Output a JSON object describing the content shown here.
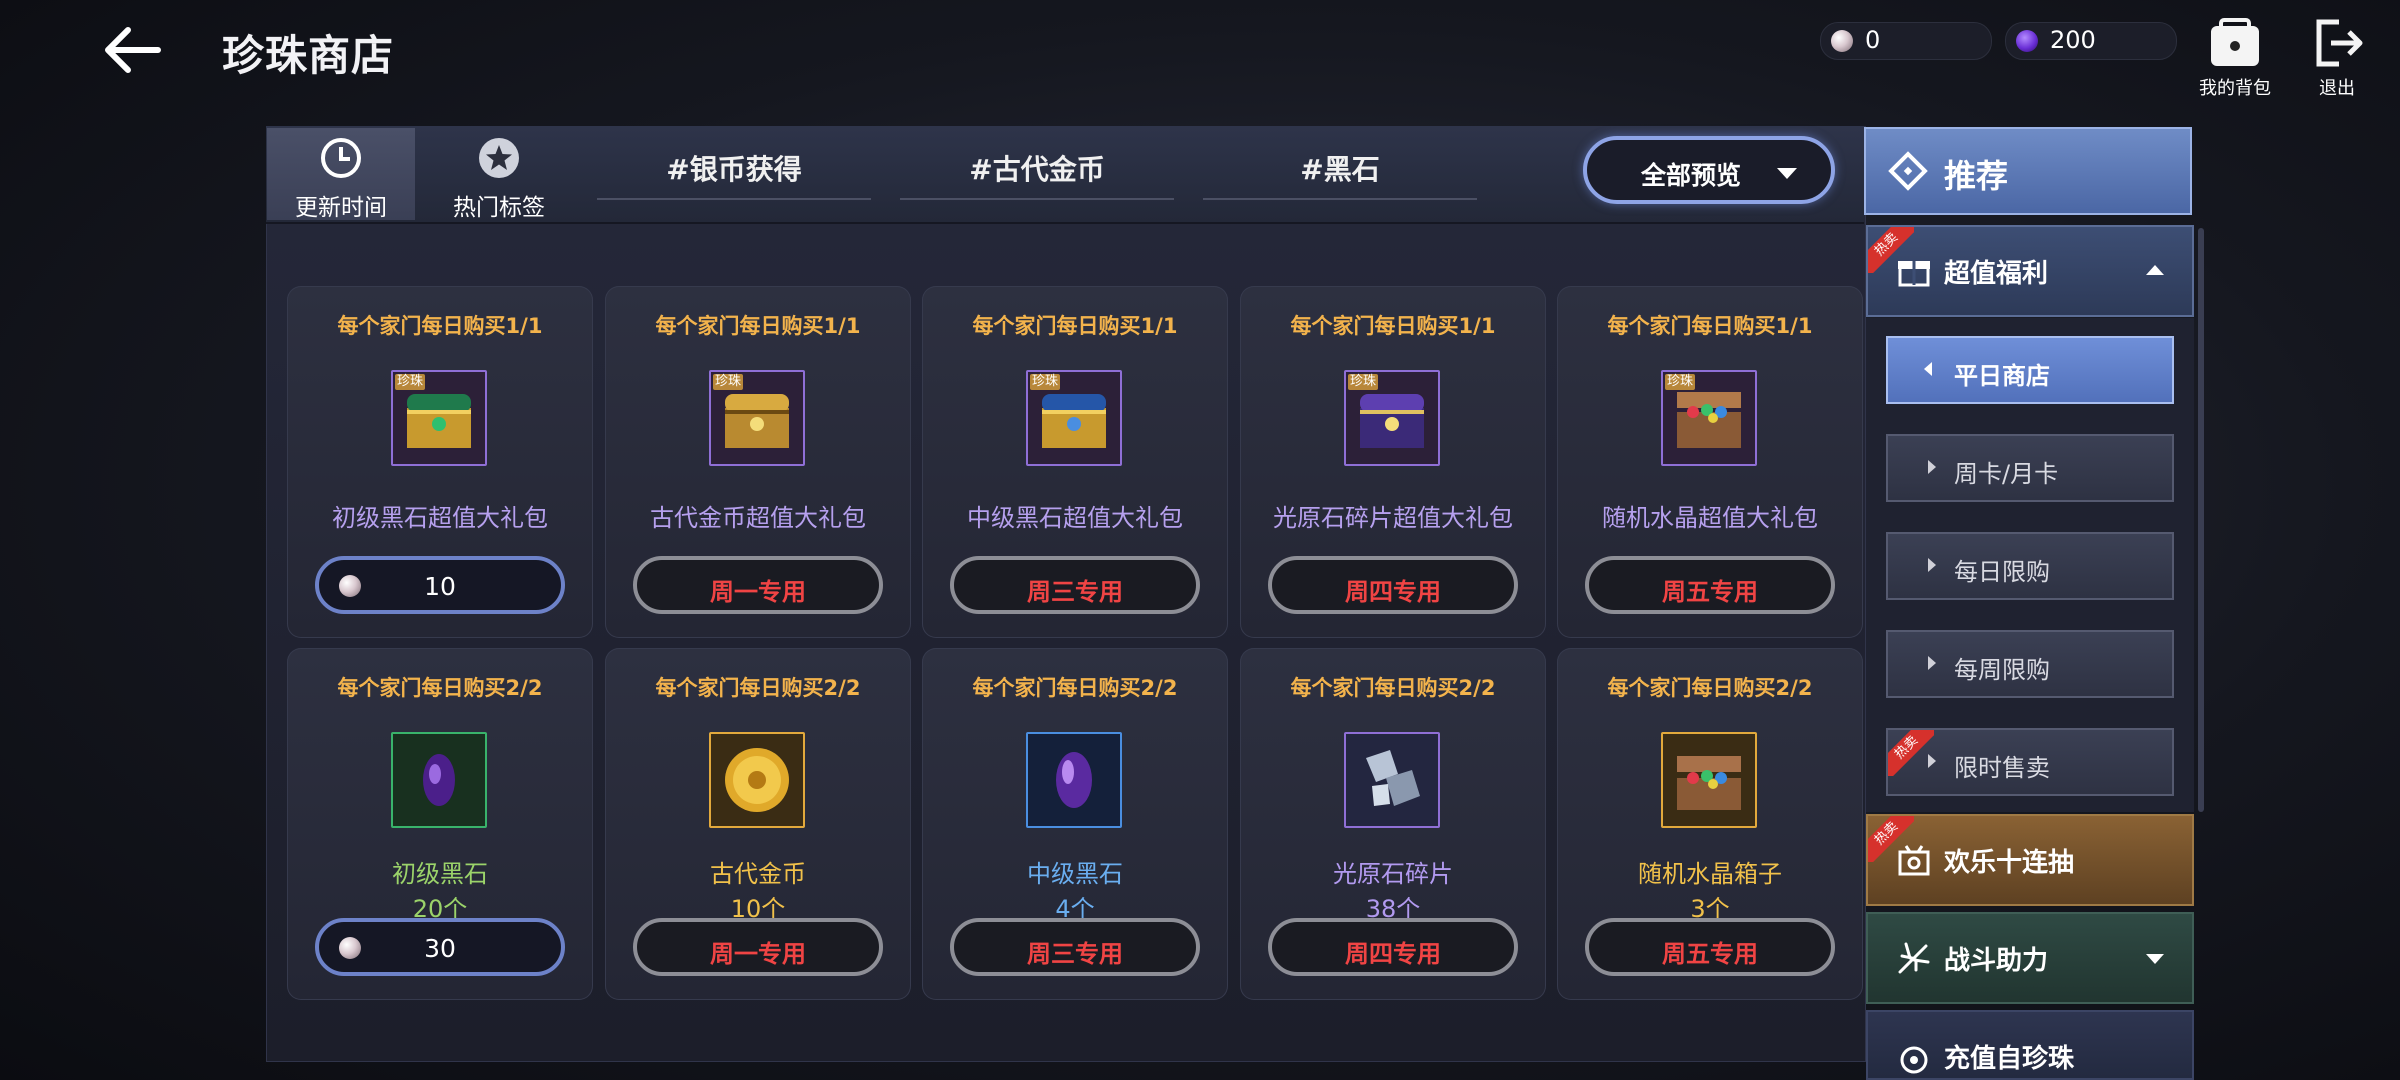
{
  "header": {
    "title": "珍珠商店",
    "back_icon": "arrow-left-icon"
  },
  "currency": {
    "pearl": {
      "value": "0",
      "icon": "pearl-icon"
    },
    "gem": {
      "value": "200",
      "icon": "purple-gem-icon"
    }
  },
  "top_actions": {
    "bag": "我的背包",
    "exit": "退出"
  },
  "tabs": {
    "update_time": "更新时间",
    "hot_tags": "热门标签",
    "tag1": "#银币获得",
    "tag2": "#古代金币",
    "tag3": "#黑石",
    "preview": "全部预览"
  },
  "badge_text": "珍珠",
  "hot_text": "热卖",
  "products_row1": [
    {
      "limit": "每个家门每日购买1/1",
      "name": "初级黑石超值大礼包",
      "button": "10",
      "button_type": "pearl"
    },
    {
      "limit": "每个家门每日购买1/1",
      "name": "古代金币超值大礼包",
      "button": "周一专用",
      "button_type": "day"
    },
    {
      "limit": "每个家门每日购买1/1",
      "name": "中级黑石超值大礼包",
      "button": "周三专用",
      "button_type": "day"
    },
    {
      "limit": "每个家门每日购买1/1",
      "name": "光原石碎片超值大礼包",
      "button": "周四专用",
      "button_type": "day"
    },
    {
      "limit": "每个家门每日购买1/1",
      "name": "随机水晶超值大礼包",
      "button": "周五专用",
      "button_type": "day"
    }
  ],
  "products_row2": [
    {
      "limit": "每个家门每日购买2/2",
      "name": "初级黑石",
      "qty": "20个",
      "button": "30",
      "button_type": "pearl",
      "name_color": "#9bd36a"
    },
    {
      "limit": "每个家门每日购买2/2",
      "name": "古代金币",
      "qty": "10个",
      "button": "周一专用",
      "button_type": "day",
      "name_color": "#f1c14a"
    },
    {
      "limit": "每个家门每日购买2/2",
      "name": "中级黑石",
      "qty": "4个",
      "button": "周三专用",
      "button_type": "day",
      "name_color": "#6aaef0"
    },
    {
      "limit": "每个家门每日购买2/2",
      "name": "光原石碎片",
      "qty": "38个",
      "button": "周四专用",
      "button_type": "day",
      "name_color": "#b29af0"
    },
    {
      "limit": "每个家门每日购买2/2",
      "name": "随机水晶箱子",
      "qty": "3个",
      "button": "周五专用",
      "button_type": "day",
      "name_color": "#f1c14a"
    }
  ],
  "sidebar": {
    "recommend": "推荐",
    "welfare": "超值福利",
    "sub_items": [
      "平日商店",
      "周卡/月卡",
      "每日限购",
      "每周限购",
      "限时售卖"
    ],
    "gacha": "欢乐十连抽",
    "battle": "战斗助力",
    "recharge": "充值自珍珠"
  },
  "colors": {
    "accent": "#6f8fd8",
    "limit_text": "#f3b34c",
    "day_button_text": "#f04444"
  }
}
